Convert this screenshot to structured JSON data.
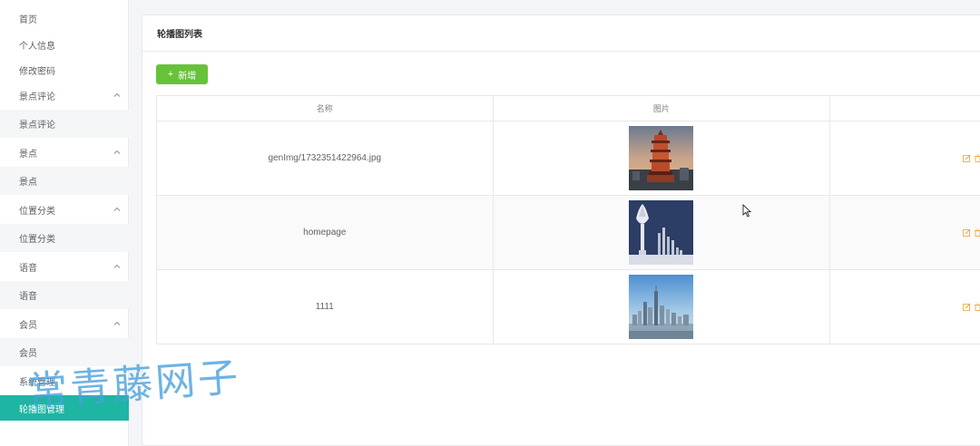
{
  "sidebar": {
    "items": [
      {
        "label": "首页",
        "type": "link"
      },
      {
        "label": "个人信息",
        "type": "link"
      },
      {
        "label": "修改密码",
        "type": "link"
      },
      {
        "label": "景点评论",
        "type": "group"
      },
      {
        "label": "景点评论",
        "type": "sub"
      },
      {
        "label": "景点",
        "type": "group"
      },
      {
        "label": "景点",
        "type": "sub"
      },
      {
        "label": "位置分类",
        "type": "group"
      },
      {
        "label": "位置分类",
        "type": "sub"
      },
      {
        "label": "语音",
        "type": "group"
      },
      {
        "label": "语音",
        "type": "sub"
      },
      {
        "label": "会员",
        "type": "group"
      },
      {
        "label": "会员",
        "type": "sub"
      },
      {
        "label": "系统管理",
        "type": "link"
      },
      {
        "label": "轮播图管理",
        "type": "active"
      }
    ]
  },
  "panel": {
    "title": "轮播图列表",
    "add_label": "新增"
  },
  "table": {
    "columns": [
      "名称",
      "图片",
      ""
    ],
    "rows": [
      {
        "name": "genImg/1732351422964.jpg",
        "image": "pagoda-photo"
      },
      {
        "name": "homepage",
        "image": "monument-photo"
      },
      {
        "name": "1111",
        "image": "skyline-photo"
      }
    ]
  },
  "watermark": "常青藤网子",
  "colors": {
    "accent": "#1fb5a3",
    "add_button": "#67c23a",
    "action": "#e6a23c"
  }
}
